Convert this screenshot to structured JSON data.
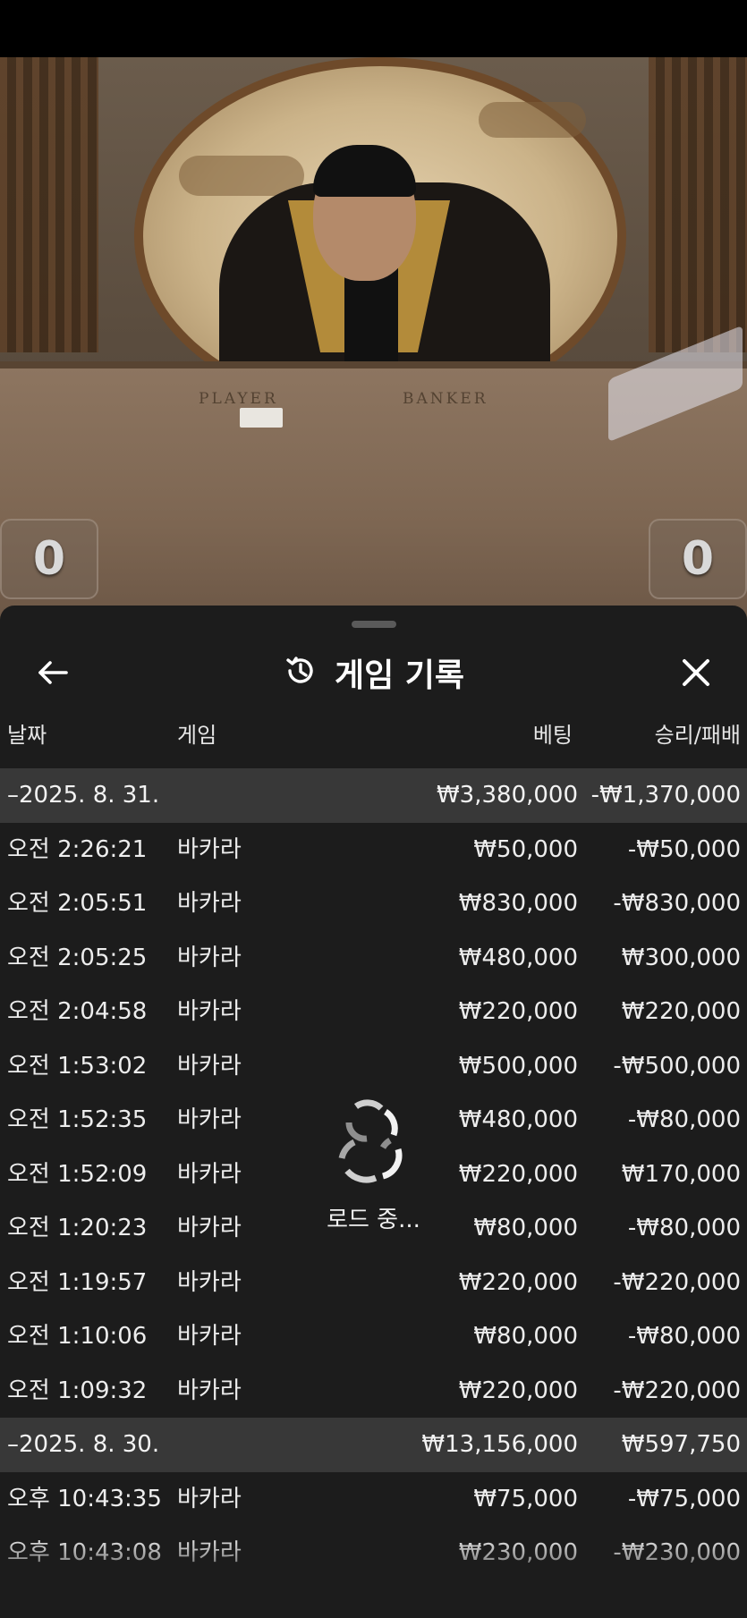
{
  "video": {
    "table_labels": [
      "PLAYER",
      "BANKER"
    ],
    "player_score": "0",
    "banker_score": "0"
  },
  "sheet": {
    "title": "게임 기록",
    "icons": {
      "back": "arrow-left-icon",
      "history": "history-icon",
      "close": "close-icon",
      "spinner": "loading-spinner-icon"
    },
    "columns": {
      "date": "날짜",
      "game": "게임",
      "bet": "베팅",
      "win_loss": "승리/패배"
    },
    "rows": [
      {
        "type": "group",
        "date": "–2025. 8. 31.",
        "game": "",
        "bet": "₩3,380,000",
        "win_loss": "-₩1,370,000"
      },
      {
        "type": "item",
        "date": "오전 2:26:21",
        "game": "바카라",
        "bet": "₩50,000",
        "win_loss": "-₩50,000"
      },
      {
        "type": "item",
        "date": "오전 2:05:51",
        "game": "바카라",
        "bet": "₩830,000",
        "win_loss": "-₩830,000"
      },
      {
        "type": "item",
        "date": "오전 2:05:25",
        "game": "바카라",
        "bet": "₩480,000",
        "win_loss": "₩300,000"
      },
      {
        "type": "item",
        "date": "오전 2:04:58",
        "game": "바카라",
        "bet": "₩220,000",
        "win_loss": "₩220,000"
      },
      {
        "type": "item",
        "date": "오전 1:53:02",
        "game": "바카라",
        "bet": "₩500,000",
        "win_loss": "-₩500,000"
      },
      {
        "type": "item",
        "date": "오전 1:52:35",
        "game": "바카라",
        "bet": "₩480,000",
        "win_loss": "-₩80,000"
      },
      {
        "type": "item",
        "date": "오전 1:52:09",
        "game": "바카라",
        "bet": "₩220,000",
        "win_loss": "₩170,000"
      },
      {
        "type": "item",
        "date": "오전 1:20:23",
        "game": "바카라",
        "bet": "₩80,000",
        "win_loss": "-₩80,000"
      },
      {
        "type": "item",
        "date": "오전 1:19:57",
        "game": "바카라",
        "bet": "₩220,000",
        "win_loss": "-₩220,000"
      },
      {
        "type": "item",
        "date": "오전 1:10:06",
        "game": "바카라",
        "bet": "₩80,000",
        "win_loss": "-₩80,000"
      },
      {
        "type": "item",
        "date": "오전 1:09:32",
        "game": "바카라",
        "bet": "₩220,000",
        "win_loss": "-₩220,000"
      },
      {
        "type": "group",
        "date": "–2025. 8. 30.",
        "game": "",
        "bet": "₩13,156,000",
        "win_loss": "₩597,750"
      },
      {
        "type": "item",
        "date": "오후 10:43:35",
        "game": "바카라",
        "bet": "₩75,000",
        "win_loss": "-₩75,000"
      },
      {
        "type": "item",
        "date": "오후 10:43:08",
        "game": "바카라",
        "bet": "₩230,000",
        "win_loss": "-₩230,000"
      }
    ],
    "loading_text": "로드 중..."
  }
}
